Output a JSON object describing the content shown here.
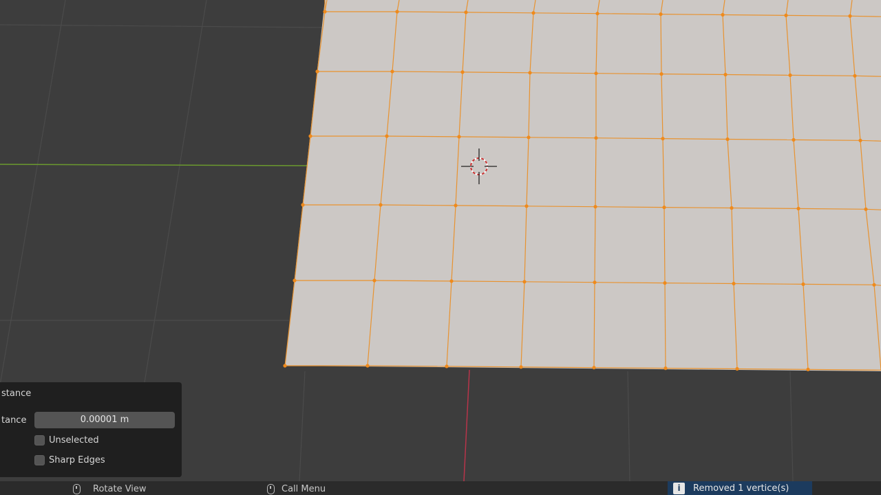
{
  "viewport": {
    "accent_edge_color": "#e8922f",
    "mesh_face_color": "#ccc8c5",
    "x_axis_color": "#6b9a2e",
    "y_axis_color": "#b8344a",
    "cursor_icon": "3d-cursor-icon"
  },
  "operator_panel": {
    "header_label": "stance",
    "distance_label": "tance",
    "distance_value": "0.00001 m",
    "unselected_label": "Unselected",
    "sharp_edges_label": "Sharp Edges"
  },
  "statusbar": {
    "rotate_view_label": "Rotate View",
    "call_menu_label": "Call Menu",
    "report_message": "Removed 1 vertice(s)",
    "report_icon": "info-icon"
  }
}
